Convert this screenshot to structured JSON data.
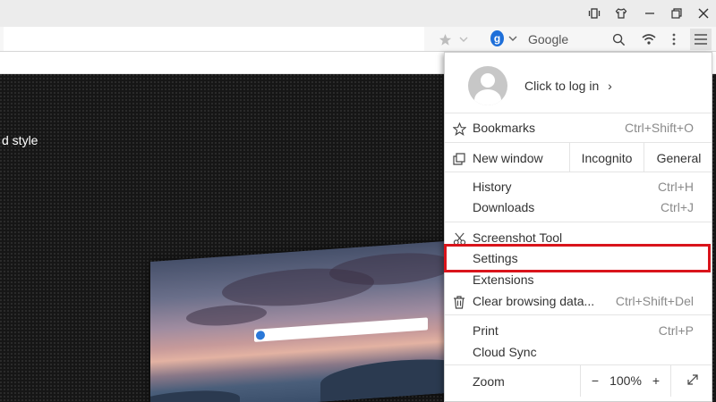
{
  "menu": {
    "login_label": "Click to log in",
    "login_chevron": "›",
    "items": [
      {
        "label": "Bookmarks",
        "shortcut": "Ctrl+Shift+O",
        "icon": "star-outline-icon"
      },
      {
        "label": "New window",
        "icon": "new-window-icon"
      },
      {
        "label": "Incognito"
      },
      {
        "label": "General"
      },
      {
        "label": "History",
        "shortcut": "Ctrl+H"
      },
      {
        "label": "Downloads",
        "shortcut": "Ctrl+J"
      },
      {
        "label": "Screenshot Tool",
        "icon": "scissors-icon"
      },
      {
        "label": "Settings"
      },
      {
        "label": "Extensions"
      },
      {
        "label": "Clear browsing data...",
        "shortcut": "Ctrl+Shift+Del",
        "icon": "trash-icon"
      },
      {
        "label": "Print",
        "shortcut": "Ctrl+P"
      },
      {
        "label": "Cloud Sync"
      }
    ],
    "zoom": {
      "label": "Zoom",
      "minus": "−",
      "value": "100%",
      "plus": "+"
    }
  },
  "addressbar": {
    "search_engine_letter": "g",
    "search_placeholder": "Google"
  },
  "page": {
    "hero_text": "d style"
  },
  "colors": {
    "highlight": "#d9141b",
    "search_badge": "#1e6fd9"
  }
}
